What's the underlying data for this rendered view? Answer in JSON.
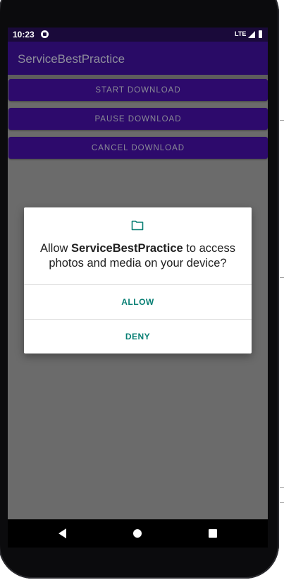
{
  "status_bar": {
    "time": "10:23",
    "network": "LTE",
    "icons": [
      "notification-icon",
      "signal-icon",
      "battery-icon"
    ]
  },
  "app_bar": {
    "title": "ServiceBestPractice"
  },
  "buttons": {
    "start": "START DOWNLOAD",
    "pause": "PAUSE DOWNLOAD",
    "cancel": "CANCEL DOWNLOAD"
  },
  "dialog": {
    "icon": "folder-icon",
    "message_prefix": "Allow ",
    "app_name": "ServiceBestPractice",
    "message_suffix": " to access photos and media on your device?",
    "allow_label": "ALLOW",
    "deny_label": "DENY"
  },
  "nav_bar": {
    "icons": [
      "back-icon",
      "home-icon",
      "recents-icon"
    ]
  },
  "colors": {
    "app_bar": "#290b66",
    "status_bar": "#1a0a3a",
    "button": "#2d0a6c",
    "scrim": "#6b6b6b",
    "dialog_accent": "#087f74"
  }
}
